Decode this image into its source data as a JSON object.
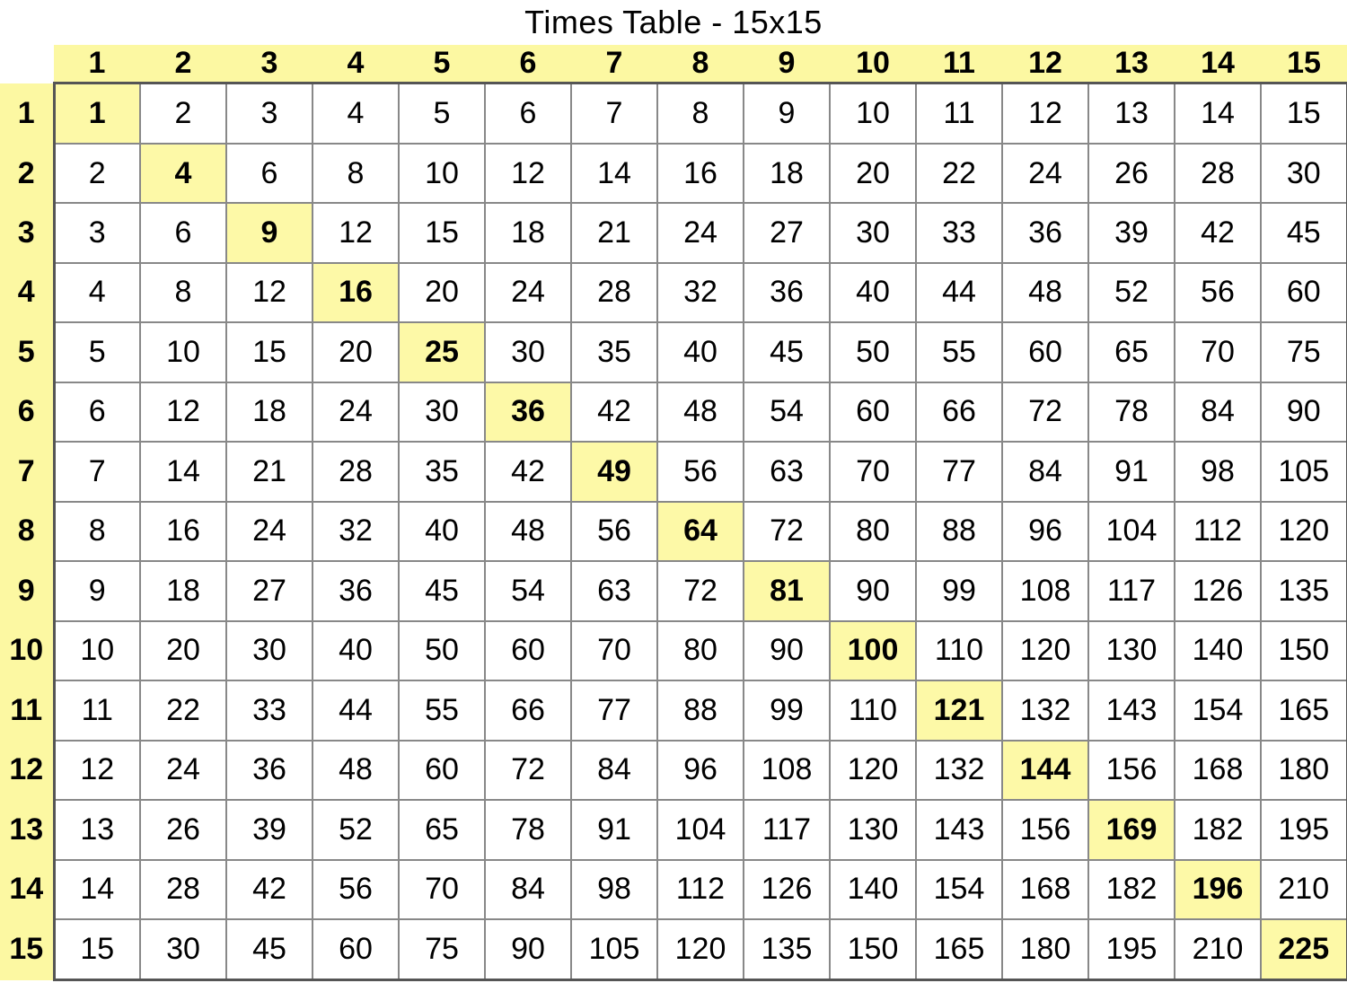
{
  "title": "Times Table - 15x15",
  "n": 15,
  "colHeaders": [
    "1",
    "2",
    "3",
    "4",
    "5",
    "6",
    "7",
    "8",
    "9",
    "10",
    "11",
    "12",
    "13",
    "14",
    "15"
  ],
  "rowHeaders": [
    "1",
    "2",
    "3",
    "4",
    "5",
    "6",
    "7",
    "8",
    "9",
    "10",
    "11",
    "12",
    "13",
    "14",
    "15"
  ],
  "rows": [
    [
      "1",
      "2",
      "3",
      "4",
      "5",
      "6",
      "7",
      "8",
      "9",
      "10",
      "11",
      "12",
      "13",
      "14",
      "15"
    ],
    [
      "2",
      "4",
      "6",
      "8",
      "10",
      "12",
      "14",
      "16",
      "18",
      "20",
      "22",
      "24",
      "26",
      "28",
      "30"
    ],
    [
      "3",
      "6",
      "9",
      "12",
      "15",
      "18",
      "21",
      "24",
      "27",
      "30",
      "33",
      "36",
      "39",
      "42",
      "45"
    ],
    [
      "4",
      "8",
      "12",
      "16",
      "20",
      "24",
      "28",
      "32",
      "36",
      "40",
      "44",
      "48",
      "52",
      "56",
      "60"
    ],
    [
      "5",
      "10",
      "15",
      "20",
      "25",
      "30",
      "35",
      "40",
      "45",
      "50",
      "55",
      "60",
      "65",
      "70",
      "75"
    ],
    [
      "6",
      "12",
      "18",
      "24",
      "30",
      "36",
      "42",
      "48",
      "54",
      "60",
      "66",
      "72",
      "78",
      "84",
      "90"
    ],
    [
      "7",
      "14",
      "21",
      "28",
      "35",
      "42",
      "49",
      "56",
      "63",
      "70",
      "77",
      "84",
      "91",
      "98",
      "105"
    ],
    [
      "8",
      "16",
      "24",
      "32",
      "40",
      "48",
      "56",
      "64",
      "72",
      "80",
      "88",
      "96",
      "104",
      "112",
      "120"
    ],
    [
      "9",
      "18",
      "27",
      "36",
      "45",
      "54",
      "63",
      "72",
      "81",
      "90",
      "99",
      "108",
      "117",
      "126",
      "135"
    ],
    [
      "10",
      "20",
      "30",
      "40",
      "50",
      "60",
      "70",
      "80",
      "90",
      "100",
      "110",
      "120",
      "130",
      "140",
      "150"
    ],
    [
      "11",
      "22",
      "33",
      "44",
      "55",
      "66",
      "77",
      "88",
      "99",
      "110",
      "121",
      "132",
      "143",
      "154",
      "165"
    ],
    [
      "12",
      "24",
      "36",
      "48",
      "60",
      "72",
      "84",
      "96",
      "108",
      "120",
      "132",
      "144",
      "156",
      "168",
      "180"
    ],
    [
      "13",
      "26",
      "39",
      "52",
      "65",
      "78",
      "91",
      "104",
      "117",
      "130",
      "143",
      "156",
      "169",
      "182",
      "195"
    ],
    [
      "14",
      "28",
      "42",
      "56",
      "70",
      "84",
      "98",
      "112",
      "126",
      "140",
      "154",
      "168",
      "182",
      "196",
      "210"
    ],
    [
      "15",
      "30",
      "45",
      "60",
      "75",
      "90",
      "105",
      "120",
      "135",
      "150",
      "165",
      "180",
      "195",
      "210",
      "225"
    ]
  ],
  "chart_data": {
    "type": "table",
    "title": "Times Table - 15x15",
    "categories": [
      1,
      2,
      3,
      4,
      5,
      6,
      7,
      8,
      9,
      10,
      11,
      12,
      13,
      14,
      15
    ],
    "series": [
      {
        "name": "1",
        "values": [
          1,
          2,
          3,
          4,
          5,
          6,
          7,
          8,
          9,
          10,
          11,
          12,
          13,
          14,
          15
        ]
      },
      {
        "name": "2",
        "values": [
          2,
          4,
          6,
          8,
          10,
          12,
          14,
          16,
          18,
          20,
          22,
          24,
          26,
          28,
          30
        ]
      },
      {
        "name": "3",
        "values": [
          3,
          6,
          9,
          12,
          15,
          18,
          21,
          24,
          27,
          30,
          33,
          36,
          39,
          42,
          45
        ]
      },
      {
        "name": "4",
        "values": [
          4,
          8,
          12,
          16,
          20,
          24,
          28,
          32,
          36,
          40,
          44,
          48,
          52,
          56,
          60
        ]
      },
      {
        "name": "5",
        "values": [
          5,
          10,
          15,
          20,
          25,
          30,
          35,
          40,
          45,
          50,
          55,
          60,
          65,
          70,
          75
        ]
      },
      {
        "name": "6",
        "values": [
          6,
          12,
          18,
          24,
          30,
          36,
          42,
          48,
          54,
          60,
          66,
          72,
          78,
          84,
          90
        ]
      },
      {
        "name": "7",
        "values": [
          7,
          14,
          21,
          28,
          35,
          42,
          49,
          56,
          63,
          70,
          77,
          84,
          91,
          98,
          105
        ]
      },
      {
        "name": "8",
        "values": [
          8,
          16,
          24,
          32,
          40,
          48,
          56,
          64,
          72,
          80,
          88,
          96,
          104,
          112,
          120
        ]
      },
      {
        "name": "9",
        "values": [
          9,
          18,
          27,
          36,
          45,
          54,
          63,
          72,
          81,
          90,
          99,
          108,
          117,
          126,
          135
        ]
      },
      {
        "name": "10",
        "values": [
          10,
          20,
          30,
          40,
          50,
          60,
          70,
          80,
          90,
          100,
          110,
          120,
          130,
          140,
          150
        ]
      },
      {
        "name": "11",
        "values": [
          11,
          22,
          33,
          44,
          55,
          66,
          77,
          88,
          99,
          110,
          121,
          132,
          143,
          154,
          165
        ]
      },
      {
        "name": "12",
        "values": [
          12,
          24,
          36,
          48,
          60,
          72,
          84,
          96,
          108,
          120,
          132,
          144,
          156,
          168,
          180
        ]
      },
      {
        "name": "13",
        "values": [
          13,
          26,
          39,
          52,
          65,
          78,
          91,
          104,
          117,
          130,
          143,
          156,
          169,
          182,
          195
        ]
      },
      {
        "name": "14",
        "values": [
          14,
          28,
          42,
          56,
          70,
          84,
          98,
          112,
          126,
          140,
          154,
          168,
          182,
          196,
          210
        ]
      },
      {
        "name": "15",
        "values": [
          15,
          30,
          45,
          60,
          75,
          90,
          105,
          120,
          135,
          150,
          165,
          180,
          195,
          210,
          225
        ]
      }
    ]
  }
}
